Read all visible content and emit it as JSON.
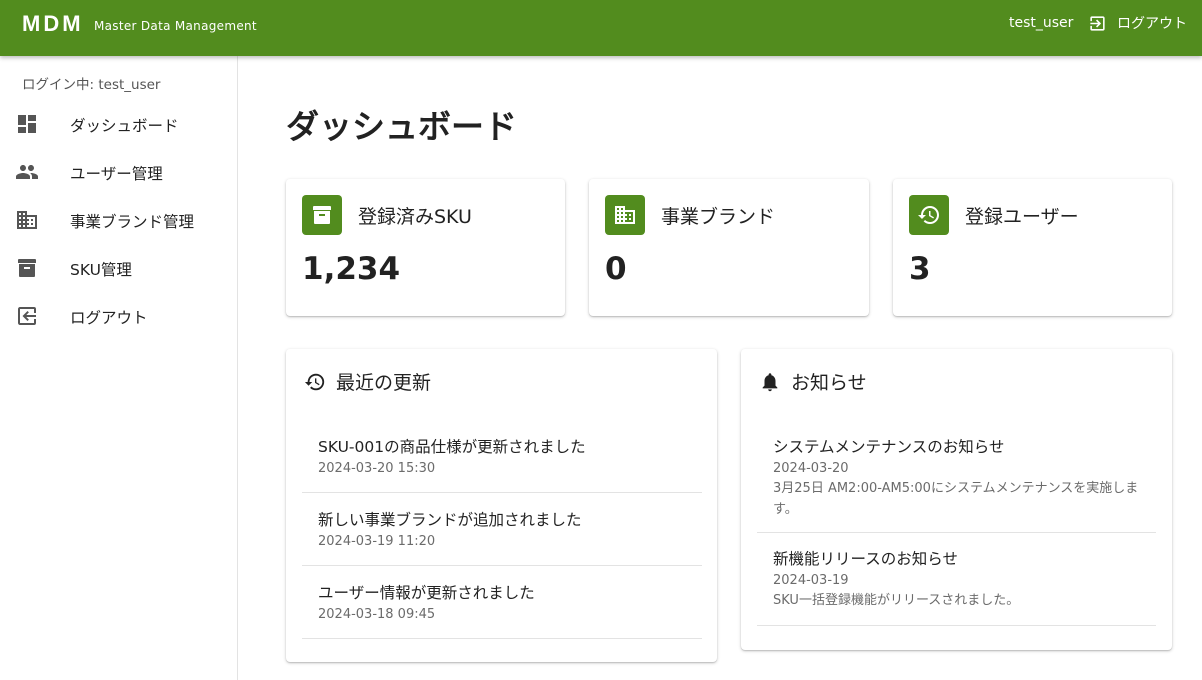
{
  "app": {
    "logo": "MDM",
    "subtitle": "Master Data Management",
    "username": "test_user",
    "logout_label": "ログアウト",
    "accent_color": "#528c1e"
  },
  "sidebar": {
    "login_status": "ログイン中: test_user",
    "items": [
      {
        "label": "ダッシュボード",
        "icon": "dashboard-icon"
      },
      {
        "label": "ユーザー管理",
        "icon": "people-icon"
      },
      {
        "label": "事業ブランド管理",
        "icon": "business-icon"
      },
      {
        "label": "SKU管理",
        "icon": "archive-icon"
      },
      {
        "label": "ログアウト",
        "icon": "logout-icon"
      }
    ]
  },
  "page": {
    "title": "ダッシュボード"
  },
  "stats": [
    {
      "label": "登録済みSKU",
      "value": "1,234",
      "icon": "archive-icon"
    },
    {
      "label": "事業ブランド",
      "value": "0",
      "icon": "business-icon"
    },
    {
      "label": "登録ユーザー",
      "value": "3",
      "icon": "history-icon"
    }
  ],
  "updates": {
    "title": "最近の更新",
    "icon": "history-icon",
    "items": [
      {
        "title": "SKU-001の商品仕様が更新されました",
        "date": "2024-03-20 15:30"
      },
      {
        "title": "新しい事業ブランドが追加されました",
        "date": "2024-03-19 11:20"
      },
      {
        "title": "ユーザー情報が更新されました",
        "date": "2024-03-18 09:45"
      }
    ]
  },
  "notices": {
    "title": "お知らせ",
    "icon": "bell-icon",
    "items": [
      {
        "title": "システムメンテナンスのお知らせ",
        "date": "2024-03-20",
        "body": "3月25日 AM2:00-AM5:00にシステムメンテナンスを実施します。"
      },
      {
        "title": "新機能リリースのお知らせ",
        "date": "2024-03-19",
        "body": "SKU一括登録機能がリリースされました。"
      }
    ]
  }
}
